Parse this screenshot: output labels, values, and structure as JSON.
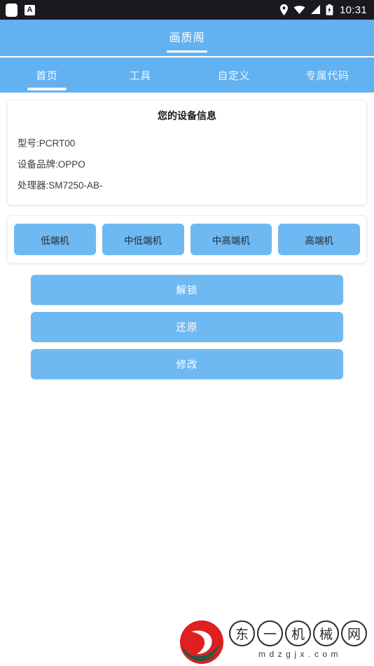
{
  "status_bar": {
    "app_icon": "app-square-icon",
    "ime_icon_label": "A",
    "icons": [
      "location-icon",
      "wifi-icon",
      "cellular-signal-icon",
      "battery-charging-icon"
    ],
    "time": "10:31"
  },
  "header": {
    "title": "画质阁"
  },
  "tabs": [
    {
      "label": "首页",
      "active": true
    },
    {
      "label": "工具",
      "active": false
    },
    {
      "label": "自定义",
      "active": false
    },
    {
      "label": "专属代码",
      "active": false
    }
  ],
  "device_card": {
    "title": "您的设备信息",
    "rows": [
      "型号:PCRT00",
      "设备品牌:OPPO",
      "处理器:SM7250-AB-"
    ]
  },
  "presets": [
    {
      "label": "低端机"
    },
    {
      "label": "中低端机"
    },
    {
      "label": "中高端机"
    },
    {
      "label": "高端机"
    }
  ],
  "actions": [
    {
      "label": "解锁"
    },
    {
      "label": "还原"
    },
    {
      "label": "修改"
    }
  ],
  "watermark": {
    "logo": "dongyi-rose-logo",
    "chars": [
      "东",
      "一",
      "机",
      "械",
      "网"
    ],
    "url": "mdzgjx.com"
  },
  "colors": {
    "accent": "#62b1f0",
    "button": "#6fb9f2",
    "status_bar": "#1a1a1e",
    "page_bg": "#ffffff"
  }
}
